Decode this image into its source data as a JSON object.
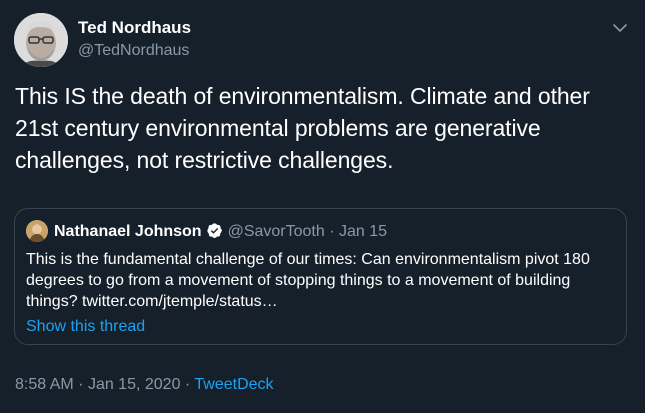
{
  "tweet": {
    "author_name": "Ted Nordhaus",
    "author_handle": "@TedNordhaus",
    "text": "This IS the death of environmentalism. Climate and other 21st century environmental problems are generative challenges, not restrictive challenges.",
    "menu_icon": "chevron-down-icon",
    "timestamp": "8:58 AM",
    "separator": "·",
    "date": "Jan 15, 2020",
    "source": "TweetDeck"
  },
  "quote": {
    "author_name": "Nathanael Johnson",
    "verified_icon": "verified-badge-icon",
    "author_handle": "@SavorTooth",
    "separator": "·",
    "date": "Jan 15",
    "text": "This is the fundamental challenge of our times: Can environmentalism pivot 180 degrees to go from a movement of stopping things to a movement of building things? twitter.com/jtemple/status…",
    "show_thread_label": "Show this thread"
  },
  "colors": {
    "background": "#15202b",
    "text_primary": "#ffffff",
    "text_secondary": "#8899a6",
    "accent": "#1da1f2",
    "border": "#38444d"
  }
}
